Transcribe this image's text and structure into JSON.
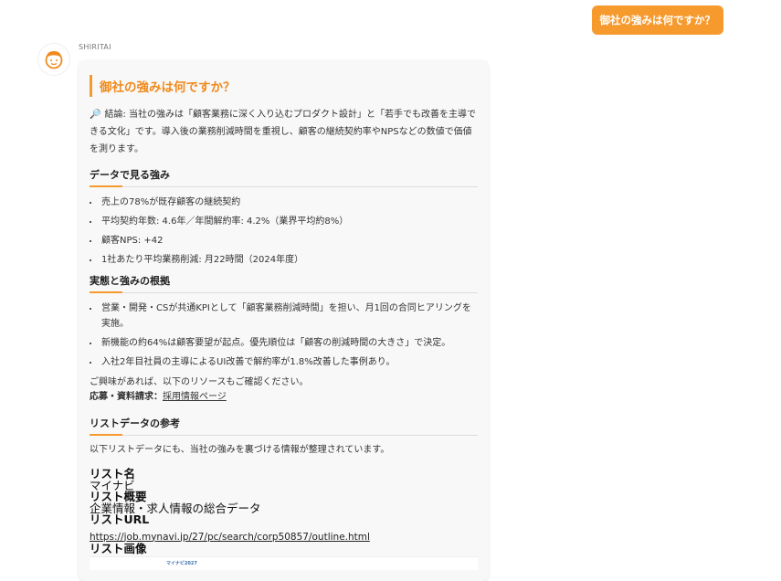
{
  "user_message": "御社の強みは何ですか？",
  "bot": {
    "name": "SHIRITAI"
  },
  "answer": {
    "title": "御社の強みは何ですか？",
    "lead_icon": "🔎",
    "lead": "結論: 当社の強みは「顧客業務に深く入り込むプロダクト設計」と「若手でも改善を主導できる文化」です。導入後の業務削減時間を重視し、顧客の継続契約率やNPSなどの数値で価値を測ります。",
    "section1": {
      "title": "データで見る強み",
      "items": [
        "売上の78%が既存顧客の継続契約",
        "平均契約年数: 4.6年／年間解約率: 4.2%（業界平均約8%）",
        "顧客NPS: +42",
        "1社あたり平均業務削減: 月22時間（2024年度）"
      ]
    },
    "section2": {
      "title": "実態と強みの根拠",
      "items": [
        "営業・開発・CSが共通KPIとして「顧客業務削減時間」を担い、月1回の合同ヒアリングを実施。",
        "新機能の約64%は顧客要望が起点。優先順位は「顧客の削減時間の大きさ」で決定。",
        "入社2年目社員の主導によるUI改善で解約率が1.8%改善した事例あり。"
      ]
    },
    "resources_text": "ご興味があれば、以下のリソースもご確認ください。",
    "apply_label": "応募・資料請求：",
    "apply_link": "採用情報ページ",
    "section3": {
      "title": "リストデータの参考",
      "text": "以下リストデータにも、当社の強みを裏づける情報が整理されています。"
    },
    "list": {
      "name_label": "リスト名",
      "name_value": "マイナビ",
      "summary_label": "リスト概要",
      "summary_value": "企業情報・求人情報の総合データ",
      "url_label": "リストURL",
      "url_value": "https://job.mynavi.jp/27/pc/search/corp50857/outline.html",
      "image_label": "リスト画像",
      "image_text": "マイナビ2027"
    }
  },
  "colors": {
    "accent": "#f79a2e",
    "title": "#f08a1c"
  }
}
